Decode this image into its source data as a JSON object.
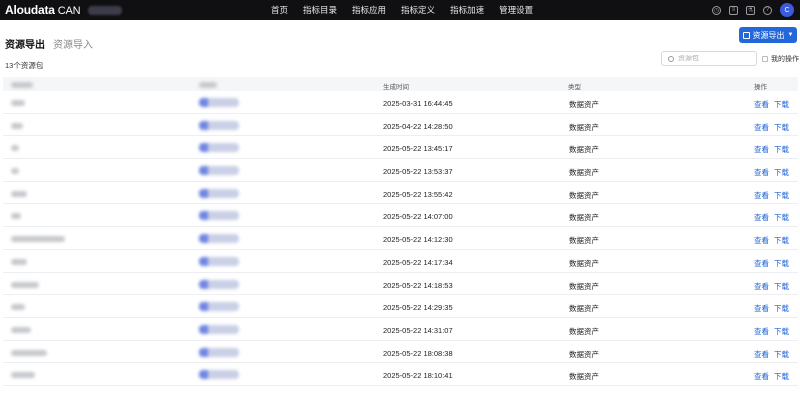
{
  "header": {
    "brand": "Aloudata",
    "edition": "CAN",
    "nav": [
      "首页",
      "指标目录",
      "指标应用",
      "指标定义",
      "指标加速",
      "管理设置"
    ],
    "icons": [
      "clock-icon",
      "document-icon",
      "flask-icon",
      "help-icon"
    ],
    "avatar_initial": "C"
  },
  "page": {
    "tabs": [
      {
        "label": "资源导出",
        "active": true
      },
      {
        "label": "资源导入",
        "active": false
      }
    ],
    "export_button": "资源导出",
    "count_text": "13个资源包",
    "search_placeholder": "资源包",
    "mine_label": "我的操作",
    "accent_color": "#2467d8"
  },
  "table": {
    "columns": [
      "生成时间",
      "类型",
      "操作"
    ],
    "rows": [
      {
        "time": "2025-03-31 16:44:45",
        "type": "数据资产",
        "view": "查看",
        "download": "下载"
      },
      {
        "time": "2025-04-22 14:28:50",
        "type": "数据资产",
        "view": "查看",
        "download": "下载"
      },
      {
        "time": "2025-05-22 13:45:17",
        "type": "数据资产",
        "view": "查看",
        "download": "下载"
      },
      {
        "time": "2025-05-22 13:53:37",
        "type": "数据资产",
        "view": "查看",
        "download": "下载"
      },
      {
        "time": "2025-05-22 13:55:42",
        "type": "数据资产",
        "view": "查看",
        "download": "下载"
      },
      {
        "time": "2025-05-22 14:07:00",
        "type": "数据资产",
        "view": "查看",
        "download": "下载"
      },
      {
        "time": "2025-05-22 14:12:30",
        "type": "数据资产",
        "view": "查看",
        "download": "下载"
      },
      {
        "time": "2025-05-22 14:17:34",
        "type": "数据资产",
        "view": "查看",
        "download": "下载"
      },
      {
        "time": "2025-05-22 14:18:53",
        "type": "数据资产",
        "view": "查看",
        "download": "下载"
      },
      {
        "time": "2025-05-22 14:29:35",
        "type": "数据资产",
        "view": "查看",
        "download": "下载"
      },
      {
        "time": "2025-05-22 14:31:07",
        "type": "数据资产",
        "view": "查看",
        "download": "下载"
      },
      {
        "time": "2025-05-22 18:08:38",
        "type": "数据资产",
        "view": "查看",
        "download": "下载"
      },
      {
        "time": "2025-05-22 18:10:41",
        "type": "数据资产",
        "view": "查看",
        "download": "下载"
      }
    ]
  }
}
